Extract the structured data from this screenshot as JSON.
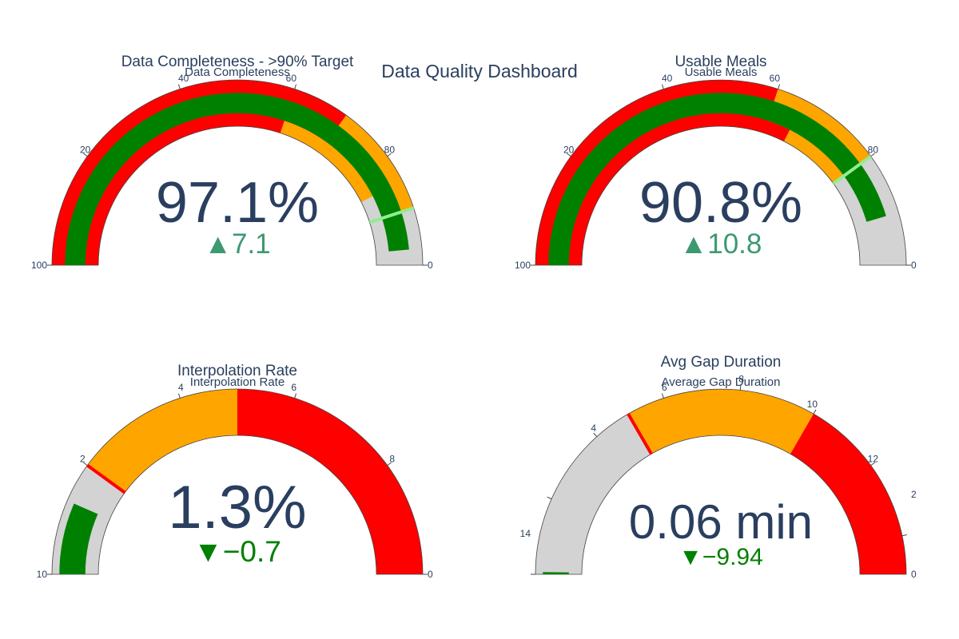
{
  "dashboard_title": "Data Quality Dashboard",
  "chart_data": [
    {
      "type": "gauge",
      "title": "Data Completeness - >90% Target",
      "subtitle": "Data Completeness",
      "value": 97.1,
      "value_display": "97.1%",
      "delta": 7.1,
      "delta_display": "▲7.1",
      "delta_direction": "up",
      "delta_color": "#3d9970",
      "range": [
        0,
        100
      ],
      "ticks": [
        "0",
        "20",
        "40",
        "60",
        "80",
        "100"
      ],
      "tick_values": [
        0,
        20,
        40,
        60,
        80,
        100
      ],
      "outer_bands": [
        {
          "from": 0,
          "to": 70,
          "color": "#ff0000"
        },
        {
          "from": 70,
          "to": 90,
          "color": "#ffa500"
        },
        {
          "from": 90,
          "to": 100,
          "color": "#d3d3d3"
        }
      ],
      "inner_bands": [
        {
          "from": 0,
          "to": 60,
          "color": "#ff0000"
        },
        {
          "from": 60,
          "to": 85,
          "color": "#ffa500"
        },
        {
          "from": 85,
          "to": 100,
          "color": "#d3d3d3"
        }
      ],
      "bar_color": "#008000",
      "threshold": 90,
      "threshold_color": "#90ee90"
    },
    {
      "type": "gauge",
      "title": "Usable Meals",
      "subtitle": "Usable Meals",
      "value": 90.8,
      "value_display": "90.8%",
      "delta": 10.8,
      "delta_display": "▲10.8",
      "delta_direction": "up",
      "delta_color": "#3d9970",
      "range": [
        0,
        100
      ],
      "ticks": [
        "0",
        "20",
        "40",
        "60",
        "80",
        "100"
      ],
      "tick_values": [
        0,
        20,
        40,
        60,
        80,
        100
      ],
      "outer_bands": [
        {
          "from": 0,
          "to": 60,
          "color": "#ff0000"
        },
        {
          "from": 60,
          "to": 80,
          "color": "#ffa500"
        },
        {
          "from": 80,
          "to": 100,
          "color": "#d3d3d3"
        }
      ],
      "inner_bands": [
        {
          "from": 0,
          "to": 65,
          "color": "#ff0000"
        },
        {
          "from": 65,
          "to": 80,
          "color": "#ffa500"
        },
        {
          "from": 80,
          "to": 100,
          "color": "#d3d3d3"
        }
      ],
      "bar_color": "#008000",
      "threshold": 80,
      "threshold_color": "#90ee90"
    },
    {
      "type": "gauge",
      "title": "Interpolation Rate",
      "subtitle": "Interpolation Rate",
      "value": 1.3,
      "value_display": "1.3%",
      "delta": -0.7,
      "delta_display": "▼−0.7",
      "delta_direction": "down",
      "delta_color": "#008000",
      "range": [
        0,
        10
      ],
      "ticks": [
        "0",
        "2",
        "4",
        "6",
        "8",
        "10"
      ],
      "tick_values": [
        0,
        2,
        4,
        6,
        8,
        10
      ],
      "outer_bands": [
        {
          "from": 0,
          "to": 2,
          "color": "#d3d3d3"
        },
        {
          "from": 2,
          "to": 5,
          "color": "#ffa500"
        },
        {
          "from": 5,
          "to": 10,
          "color": "#ff0000"
        }
      ],
      "inner_bands": [],
      "bar_color": "#008000",
      "threshold": 2,
      "threshold_color": "#ff0000"
    },
    {
      "type": "gauge",
      "title": "Avg Gap Duration",
      "subtitle": "Average Gap Duration",
      "value": 0.06,
      "value_display": "0.06 min",
      "delta": -9.94,
      "delta_display": "▼−9.94",
      "delta_direction": "down",
      "delta_color": "#008000",
      "range": [
        0,
        15
      ],
      "ticks": [
        "0",
        "2",
        "4",
        "6",
        "8",
        "10",
        "12",
        "14"
      ],
      "tick_values": [
        0,
        2,
        4,
        6,
        8,
        10,
        12,
        14
      ],
      "outer_bands": [
        {
          "from": 0,
          "to": 5,
          "color": "#d3d3d3"
        },
        {
          "from": 5,
          "to": 10,
          "color": "#ffa500"
        },
        {
          "from": 10,
          "to": 15,
          "color": "#ff0000"
        }
      ],
      "inner_bands": [],
      "bar_color": "#008000",
      "threshold": 5,
      "threshold_color": "#ff0000"
    }
  ]
}
